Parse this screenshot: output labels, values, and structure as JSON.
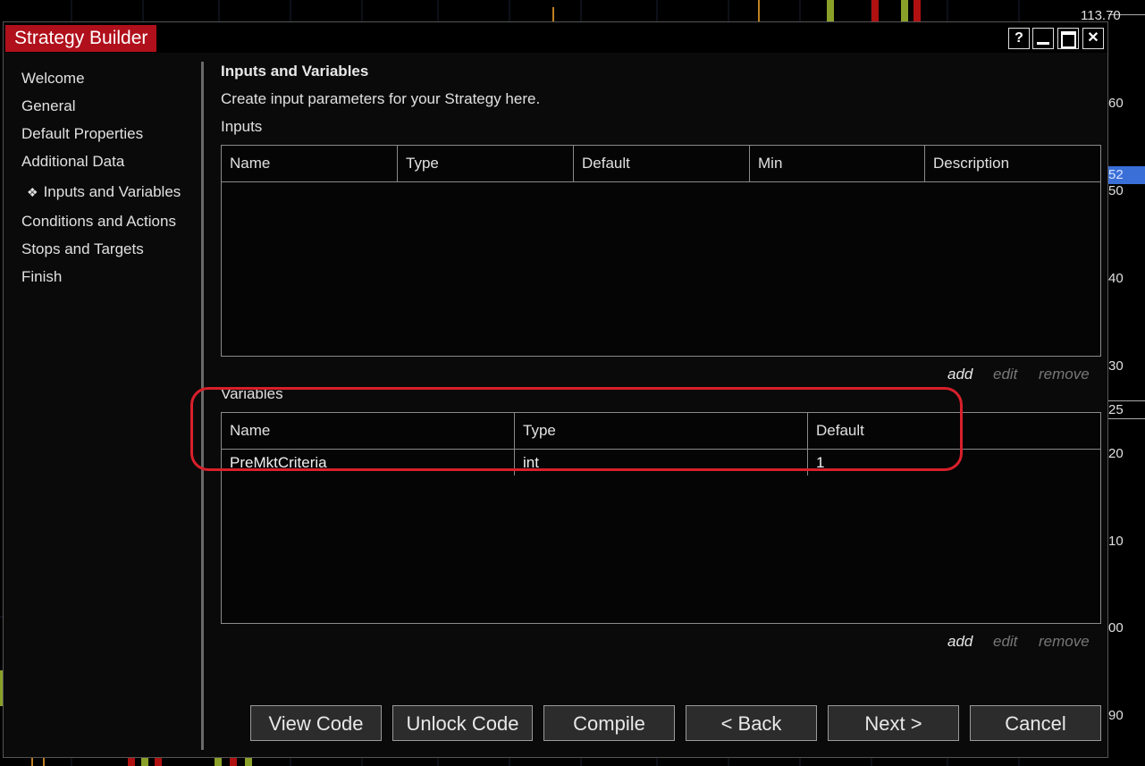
{
  "window": {
    "title": "Strategy Builder",
    "controls": {
      "help": "?",
      "minimize": "—",
      "maximize": "☐",
      "close": "✕"
    }
  },
  "sidebar": {
    "items": [
      {
        "label": "Welcome"
      },
      {
        "label": "General"
      },
      {
        "label": "Default Properties"
      },
      {
        "label": "Additional Data"
      },
      {
        "label": "Inputs and Variables",
        "active": true,
        "bullet": "❖"
      },
      {
        "label": "Conditions and Actions"
      },
      {
        "label": "Stops and Targets"
      },
      {
        "label": "Finish"
      }
    ]
  },
  "main": {
    "heading": "Inputs and Variables",
    "subheading": "Create input parameters for your Strategy here.",
    "inputs": {
      "label": "Inputs",
      "columns": [
        "Name",
        "Type",
        "Default",
        "Min",
        "Description"
      ],
      "rows": []
    },
    "variables": {
      "label": "Variables",
      "columns": [
        "Name",
        "Type",
        "Default"
      ],
      "rows": [
        {
          "name": "PreMktCriteria",
          "type": "int",
          "default": "1"
        }
      ]
    },
    "grid_actions": {
      "add": "add",
      "edit": "edit",
      "remove": "remove"
    }
  },
  "footer": {
    "view_code": "View Code",
    "unlock_code": "Unlock Code",
    "compile": "Compile",
    "back": "< Back",
    "next": "Next >",
    "cancel": "Cancel"
  },
  "background": {
    "price_labels": [
      "113.70",
      "60",
      "52",
      "50",
      "40",
      "30",
      "25",
      "20",
      "10",
      "00",
      "90"
    ],
    "colors": {
      "up": "#8aa028",
      "down": "#b01010",
      "highlight": "#3a6fd8"
    }
  },
  "colors": {
    "title_bar": "#b0101b",
    "annotation": "#d8202b",
    "dialog_bg": "#0a0a0a"
  }
}
